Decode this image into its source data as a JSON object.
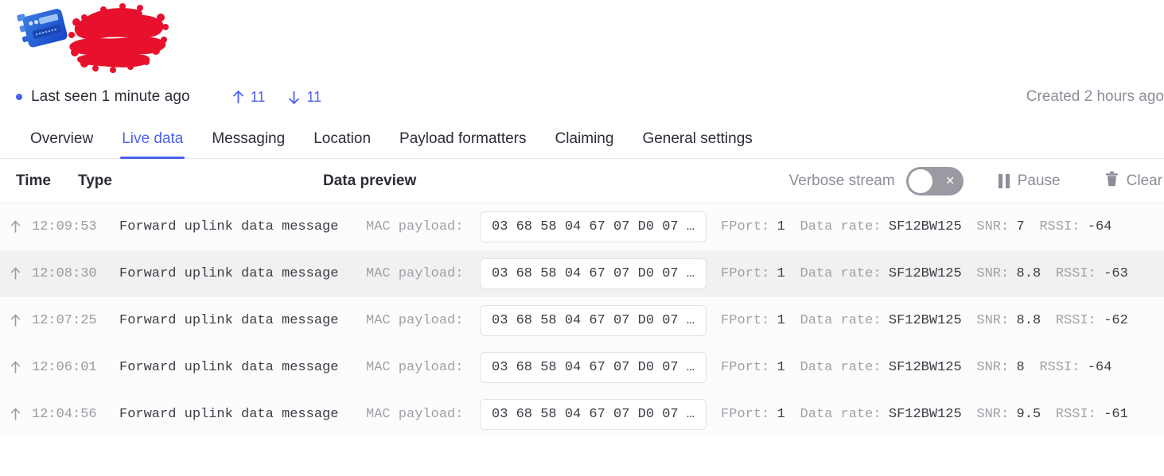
{
  "header": {
    "device_icon_name": "lora-device-icon",
    "device_name_redacted": "eui-0000",
    "redaction_color": "#e8112d"
  },
  "status": {
    "dot_color": "#4a61f0",
    "last_seen": "Last seen 1 minute ago",
    "uplink_count": "11",
    "downlink_count": "11",
    "created": "Created 2 hours ago"
  },
  "tabs": [
    {
      "label": "Overview",
      "active": false
    },
    {
      "label": "Live data",
      "active": true
    },
    {
      "label": "Messaging",
      "active": false
    },
    {
      "label": "Location",
      "active": false
    },
    {
      "label": "Payload formatters",
      "active": false
    },
    {
      "label": "Claiming",
      "active": false
    },
    {
      "label": "General settings",
      "active": false
    }
  ],
  "table": {
    "columns": {
      "time": "Time",
      "type": "Type",
      "data_preview": "Data preview"
    },
    "controls": {
      "verbose_label": "Verbose stream",
      "verbose_enabled": false,
      "verbose_toggle_glyph": "×",
      "pause_label": "Pause",
      "clear_label": "Clear"
    },
    "rows": [
      {
        "direction": "uplink",
        "time": "12:09:53",
        "type": "Forward uplink data message",
        "mac_label": "MAC payload:",
        "payload": "03 68 58 04 67 07 D0 07 …",
        "fport_key": "FPort:",
        "fport": "1",
        "datarate_key": "Data rate:",
        "datarate": "SF12BW125",
        "snr_key": "SNR:",
        "snr": "7",
        "rssi_key": "RSSI:",
        "rssi": "-64"
      },
      {
        "direction": "uplink",
        "time": "12:08:30",
        "type": "Forward uplink data message",
        "mac_label": "MAC payload:",
        "payload": "03 68 58 04 67 07 D0 07 …",
        "fport_key": "FPort:",
        "fport": "1",
        "datarate_key": "Data rate:",
        "datarate": "SF12BW125",
        "snr_key": "SNR:",
        "snr": "8.8",
        "rssi_key": "RSSI:",
        "rssi": "-63"
      },
      {
        "direction": "uplink",
        "time": "12:07:25",
        "type": "Forward uplink data message",
        "mac_label": "MAC payload:",
        "payload": "03 68 58 04 67 07 D0 07 …",
        "fport_key": "FPort:",
        "fport": "1",
        "datarate_key": "Data rate:",
        "datarate": "SF12BW125",
        "snr_key": "SNR:",
        "snr": "8.8",
        "rssi_key": "RSSI:",
        "rssi": "-62"
      },
      {
        "direction": "uplink",
        "time": "12:06:01",
        "type": "Forward uplink data message",
        "mac_label": "MAC payload:",
        "payload": "03 68 58 04 67 07 D0 07 …",
        "fport_key": "FPort:",
        "fport": "1",
        "datarate_key": "Data rate:",
        "datarate": "SF12BW125",
        "snr_key": "SNR:",
        "snr": "8",
        "rssi_key": "RSSI:",
        "rssi": "-64"
      },
      {
        "direction": "uplink",
        "time": "12:04:56",
        "type": "Forward uplink data message",
        "mac_label": "MAC payload:",
        "payload": "03 68 58 04 67 07 D0 07 …",
        "fport_key": "FPort:",
        "fport": "1",
        "datarate_key": "Data rate:",
        "datarate": "SF12BW125",
        "snr_key": "SNR:",
        "snr": "9.5",
        "rssi_key": "RSSI:",
        "rssi": "-61"
      }
    ]
  }
}
